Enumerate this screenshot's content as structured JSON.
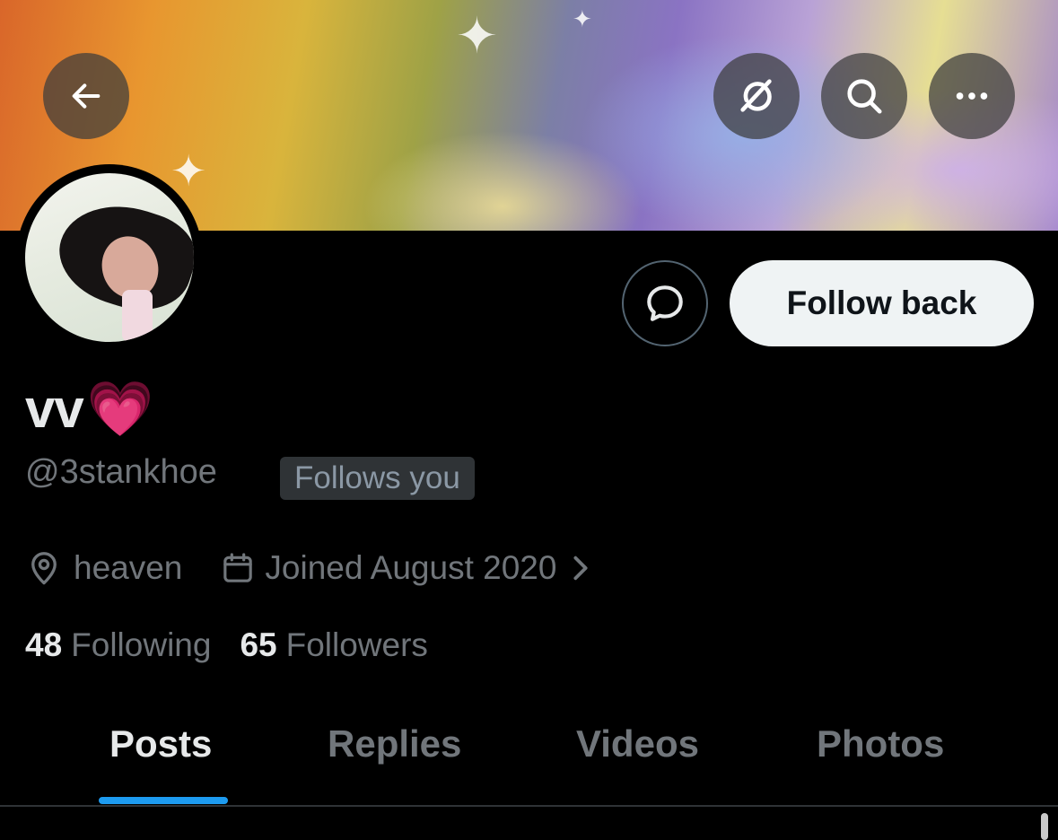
{
  "header": {
    "back_icon": "arrow-left-icon",
    "grok_icon": "grok-icon",
    "search_icon": "search-icon",
    "more_icon": "more-horizontal-icon"
  },
  "profile": {
    "display_name": "vv",
    "name_emoji": "💗",
    "handle": "@3stankhoe",
    "follows_you_badge": "Follows you",
    "location": "heaven",
    "joined": "Joined August 2020",
    "following_count": "48",
    "following_label": "Following",
    "followers_count": "65",
    "followers_label": "Followers"
  },
  "actions": {
    "message_icon": "chat-bubble-icon",
    "follow_back_label": "Follow back"
  },
  "tabs": [
    {
      "label": "Posts",
      "active": true
    },
    {
      "label": "Replies",
      "active": false
    },
    {
      "label": "Videos",
      "active": false
    },
    {
      "label": "Photos",
      "active": false
    }
  ],
  "colors": {
    "accent": "#1d9bf0",
    "background": "#000000",
    "muted_text": "#71767b"
  }
}
